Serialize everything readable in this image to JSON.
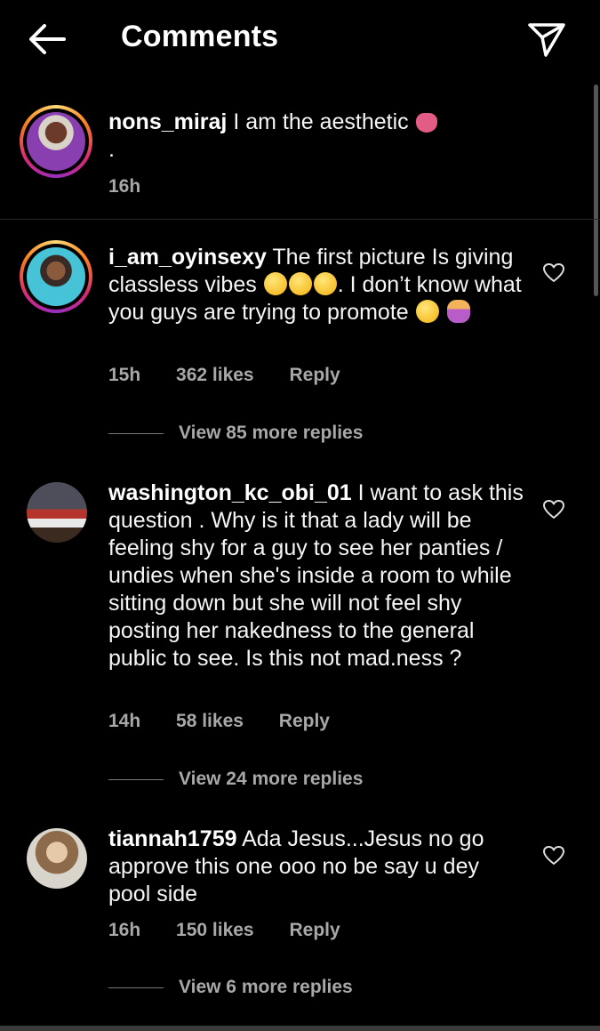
{
  "header": {
    "title": "Comments"
  },
  "comments": [
    {
      "username": "nons_miraj",
      "text": "I am the aesthetic",
      "emojis": [
        "tongue"
      ],
      "extra_line": ".",
      "time": "16h"
    },
    {
      "username": "i_am_oyinsexy",
      "text_a": "The first picture Is giving classless vibes",
      "emojis_a": [
        "eye-roll",
        "flushed",
        "unamused"
      ],
      "text_b": ". I don’t know what you guys are trying to promote",
      "emojis_b": [
        "unamused",
        "person-shrugging"
      ],
      "time": "15h",
      "likes": "362 likes",
      "reply_label": "Reply",
      "view_replies": "View 85 more replies"
    },
    {
      "username": "washington_kc_obi_01",
      "text": "I want to ask this question . Why is it that a lady will be feeling shy for a guy to see her panties / undies  when she's inside  a room to while sitting down but she will not feel shy posting her nakedness to the general public to see. Is this not mad.ness ?",
      "time": "14h",
      "likes": "58 likes",
      "reply_label": "Reply",
      "view_replies": "View 24 more replies"
    },
    {
      "username": "tiannah1759",
      "text": "Ada Jesus...Jesus no go approve this one ooo no be say u dey pool side",
      "time": "16h",
      "likes": "150 likes",
      "reply_label": "Reply",
      "view_replies": "View 6 more replies"
    }
  ],
  "colors": {
    "background": "#000000",
    "secondary_text": "#a8a8a8",
    "divider": "#262626"
  }
}
